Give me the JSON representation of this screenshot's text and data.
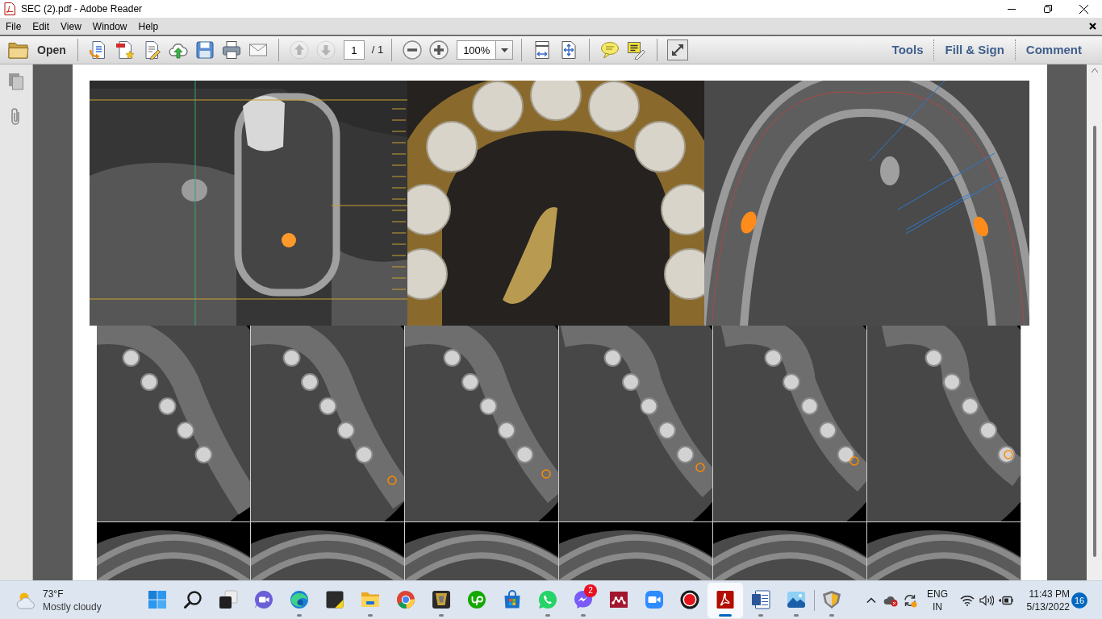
{
  "window": {
    "title": "SEC (2).pdf - Adobe Reader"
  },
  "menu": [
    "File",
    "Edit",
    "View",
    "Window",
    "Help"
  ],
  "toolbar": {
    "groups": [
      [
        {
          "kind": "open",
          "label": "Open",
          "disabled": false
        }
      ],
      [
        {
          "kind": "create",
          "disabled": false
        },
        {
          "kind": "convert",
          "disabled": false
        },
        {
          "kind": "edit",
          "disabled": false
        },
        {
          "kind": "upload",
          "disabled": false
        },
        {
          "kind": "save",
          "disabled": false
        },
        {
          "kind": "print",
          "disabled": false
        },
        {
          "kind": "email",
          "disabled": false
        }
      ],
      [
        {
          "kind": "previous_page",
          "disabled": true
        },
        {
          "kind": "next_page",
          "disabled": true
        },
        {
          "kind": "page_field",
          "value": "1",
          "total": "/ 1",
          "disabled": false
        }
      ],
      [
        {
          "kind": "zoom_out",
          "disabled": false
        },
        {
          "kind": "zoom_in",
          "disabled": false
        },
        {
          "kind": "zoom_field",
          "value": "100%",
          "disabled": false
        }
      ],
      [
        {
          "kind": "fit_width",
          "disabled": false
        },
        {
          "kind": "fit_page",
          "disabled": false
        }
      ],
      [
        {
          "kind": "comment",
          "disabled": false
        },
        {
          "kind": "highlight",
          "disabled": false
        }
      ],
      [
        {
          "kind": "full_screen",
          "disabled": false
        }
      ]
    ],
    "panels": [
      "Tools",
      "Fill & Sign",
      "Comment"
    ]
  },
  "taskbar": {
    "weather": {
      "temperature": "73°F",
      "condition": "Mostly cloudy"
    },
    "apps": [
      {
        "kind": "start",
        "running": false,
        "selected": false
      },
      {
        "kind": "search",
        "running": false,
        "selected": false
      },
      {
        "kind": "task_view",
        "running": false,
        "selected": false
      },
      {
        "kind": "video_chat",
        "running": false,
        "selected": false
      },
      {
        "kind": "browser_wave",
        "running": true,
        "selected": false
      },
      {
        "kind": "notes",
        "running": false,
        "selected": false
      },
      {
        "kind": "folder",
        "running": true,
        "selected": false
      },
      {
        "kind": "browser_ring",
        "running": false,
        "selected": false
      },
      {
        "kind": "app_3d",
        "running": true,
        "selected": false
      },
      {
        "kind": "app_round",
        "running": false,
        "selected": false
      },
      {
        "kind": "store",
        "running": false,
        "selected": false
      },
      {
        "kind": "chat_phone",
        "running": true,
        "selected": false
      },
      {
        "kind": "chat_bolt",
        "running": true,
        "selected": false,
        "badge": "2"
      },
      {
        "kind": "app_network",
        "running": false,
        "selected": false
      },
      {
        "kind": "video_call",
        "running": false,
        "selected": false
      },
      {
        "kind": "recorder",
        "running": false,
        "selected": false
      },
      {
        "kind": "pdf_reader",
        "running": true,
        "selected": true
      },
      {
        "kind": "document",
        "running": true,
        "selected": false
      },
      {
        "kind": "photos",
        "running": true,
        "selected": false
      }
    ],
    "extra_apps": [
      {
        "kind": "app_shield",
        "running": true,
        "selected": false
      }
    ],
    "tray": {
      "language": "ENG",
      "region": "IN",
      "time": "11:43 PM",
      "date": "5/13/2022",
      "notification_count": "16"
    }
  }
}
